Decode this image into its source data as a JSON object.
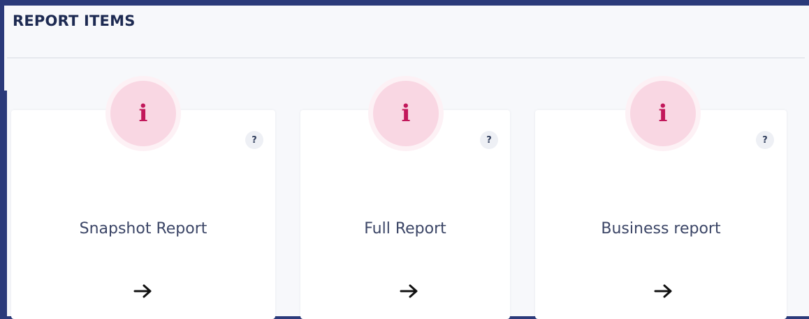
{
  "section": {
    "title": "REPORT ITEMS"
  },
  "cards": [
    {
      "label": "Snapshot Report",
      "badge_icon": "info-icon",
      "badge_glyph": "i",
      "help_glyph": "?",
      "action_icon": "arrow-right-icon"
    },
    {
      "label": "Full Report",
      "badge_icon": "info-icon",
      "badge_glyph": "i",
      "help_glyph": "?",
      "action_icon": "arrow-right-icon"
    },
    {
      "label": "Business report",
      "badge_icon": "info-icon",
      "badge_glyph": "i",
      "help_glyph": "?",
      "action_icon": "arrow-right-icon"
    }
  ],
  "colors": {
    "frame": "#2b3a7a",
    "panel_background": "#f7f8fb",
    "card_background": "#ffffff",
    "title_text": "#1d2a52",
    "badge_fill": "#f9d7e3",
    "badge_glyph": "#c2185b",
    "label_text": "#3b4566"
  }
}
